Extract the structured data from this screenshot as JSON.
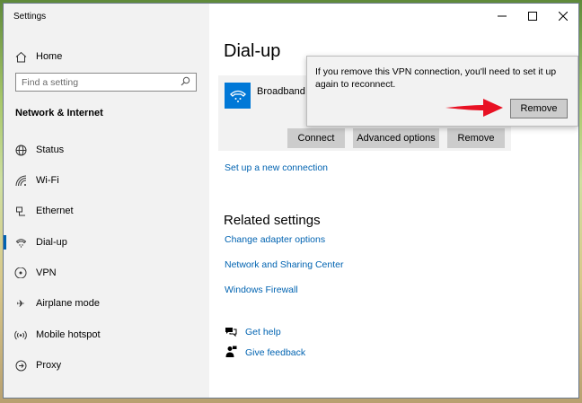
{
  "window": {
    "title": "Settings",
    "minimize_icon": "minimize-icon",
    "maximize_icon": "maximize-icon",
    "close_icon": "close-icon"
  },
  "sidebar": {
    "home_label": "Home",
    "search_placeholder": "Find a setting",
    "section_title": "Network & Internet",
    "items": [
      {
        "label": "Status",
        "icon": "globe-icon"
      },
      {
        "label": "Wi-Fi",
        "icon": "wifi-icon"
      },
      {
        "label": "Ethernet",
        "icon": "ethernet-icon"
      },
      {
        "label": "Dial-up",
        "icon": "dialup-icon",
        "active": true
      },
      {
        "label": "VPN",
        "icon": "vpn-icon"
      },
      {
        "label": "Airplane mode",
        "icon": "airplane-icon"
      },
      {
        "label": "Mobile hotspot",
        "icon": "hotspot-icon"
      },
      {
        "label": "Proxy",
        "icon": "proxy-icon"
      }
    ]
  },
  "main": {
    "title": "Dial-up",
    "connection": {
      "name": "Broadband C",
      "buttons": {
        "connect": "Connect",
        "advanced": "Advanced options",
        "remove": "Remove"
      }
    },
    "setup_link": "Set up a new connection",
    "related_title": "Related settings",
    "related_links": [
      "Change adapter options",
      "Network and Sharing Center",
      "Windows Firewall"
    ],
    "help": {
      "get_help": "Get help",
      "give_feedback": "Give feedback"
    }
  },
  "flyout": {
    "message": "If you remove this VPN connection, you'll need to set it up again to reconnect.",
    "remove_label": "Remove"
  },
  "colors": {
    "accent": "#0078d7",
    "link": "#0063b1",
    "arrow": "#e81123"
  }
}
